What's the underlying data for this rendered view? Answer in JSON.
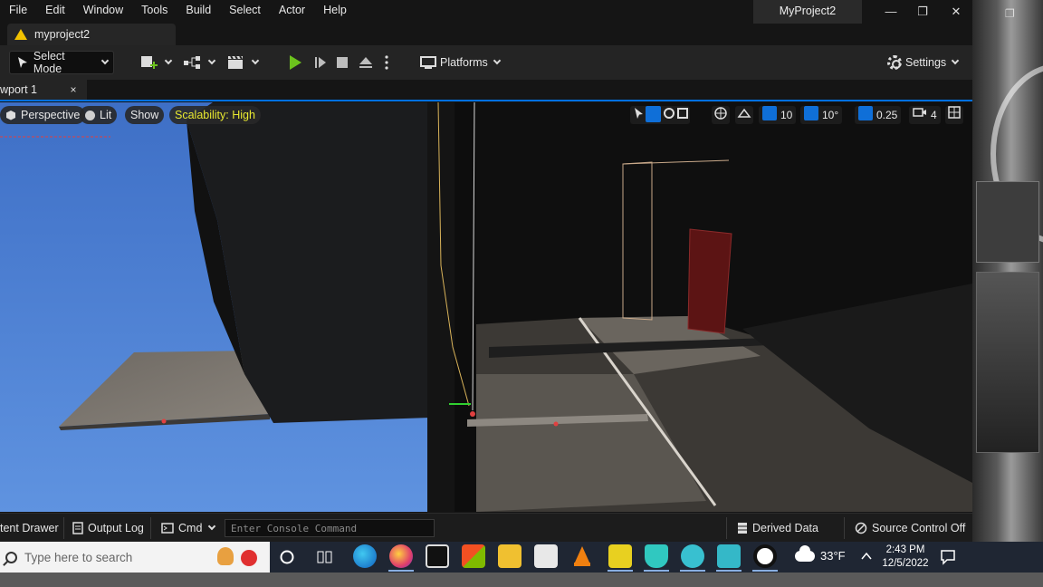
{
  "menu": [
    "File",
    "Edit",
    "Window",
    "Tools",
    "Build",
    "Select",
    "Actor",
    "Help"
  ],
  "window": {
    "title": "MyProject2",
    "minimize": "—",
    "maximize": "❐",
    "close": "✕"
  },
  "desktop": {
    "restore": "❐"
  },
  "project_tab": {
    "label": "myproject2"
  },
  "toolbar": {
    "select_mode": "Select Mode",
    "platforms": "Platforms",
    "settings": "Settings"
  },
  "viewport_tab": {
    "label": "wport 1",
    "close": "×"
  },
  "viewport": {
    "perspective": "Perspective",
    "lit": "Lit",
    "show": "Show",
    "scalability": "Scalability: High",
    "grid_snap": "10",
    "rotation_snap": "10°",
    "scale_snap": "0.25",
    "camera_speed": "4"
  },
  "bottom": {
    "content_drawer": "tent Drawer",
    "output_log": "Output Log",
    "cmd": "Cmd",
    "console_placeholder": "Enter Console Command",
    "derived_data": "Derived Data",
    "source_control": "Source Control Off"
  },
  "taskbar": {
    "search_placeholder": "Type here to search",
    "weather": "33°F",
    "time": "2:43 PM",
    "date": "12/5/2022"
  },
  "colors": {
    "accent": "#0070e0",
    "play": "#6cc21d",
    "warning": "#f2c200",
    "scalability": "#e8e830"
  }
}
